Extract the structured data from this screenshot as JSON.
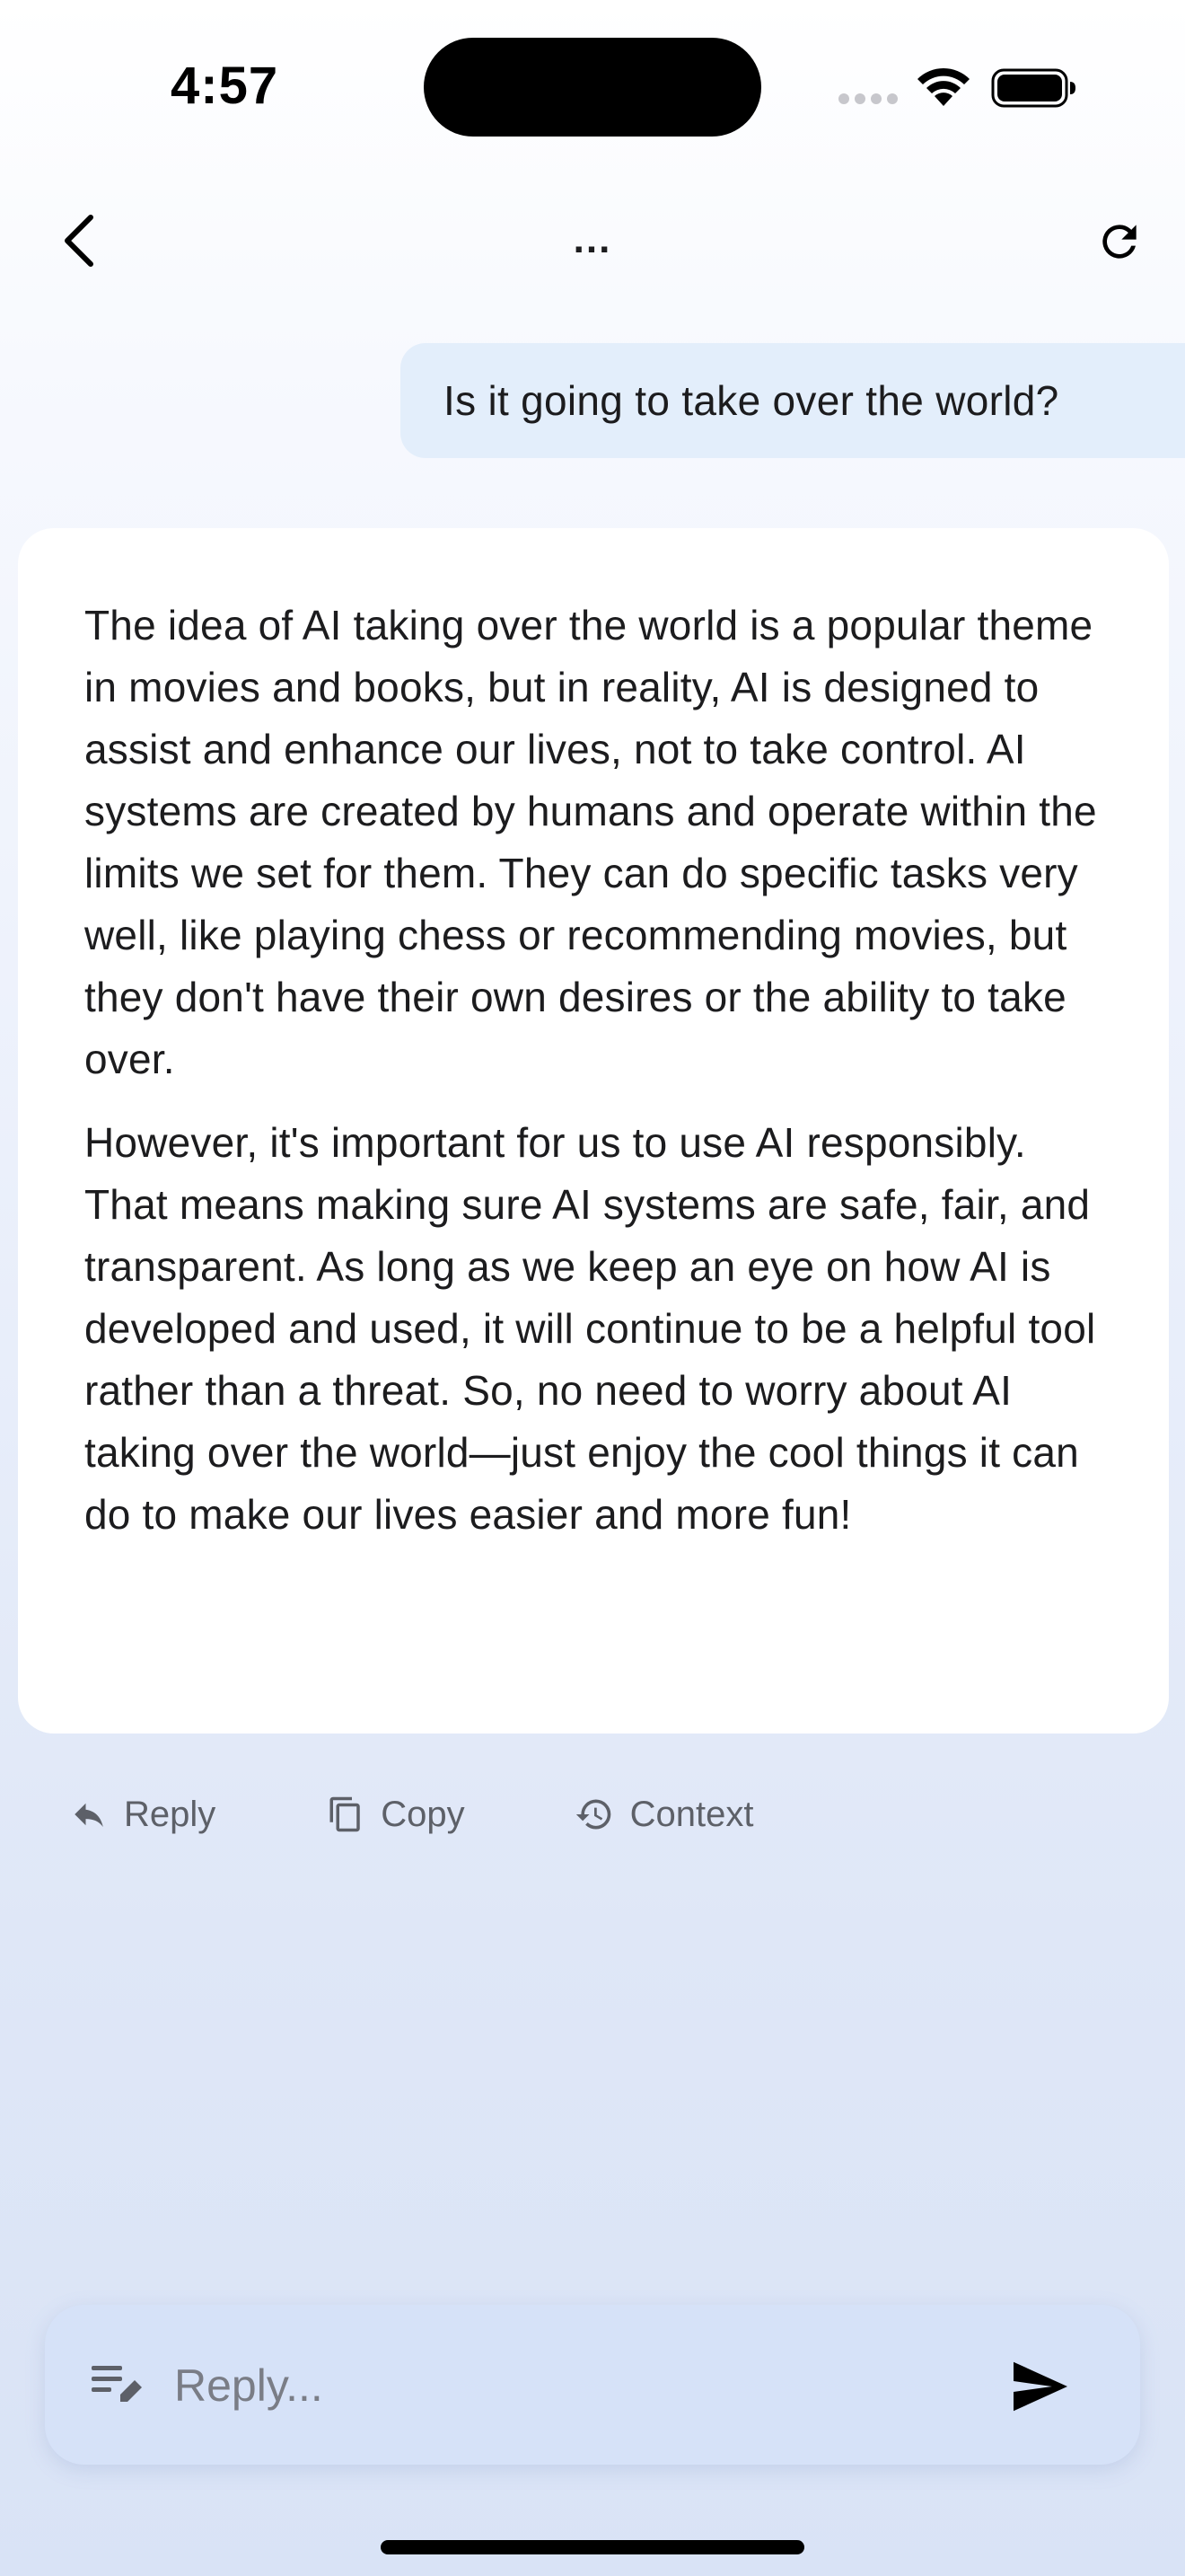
{
  "status_bar": {
    "time": "4:57"
  },
  "nav": {
    "title": "...",
    "back_icon": "chevron-left-icon",
    "refresh_icon": "refresh-icon"
  },
  "conversation": {
    "user_message": "Is it going to take over the world?",
    "assistant_paragraphs": [
      "The idea of AI taking over the world is a popular theme in movies and books, but in reality, AI is designed to assist and enhance our lives, not to take control. AI systems are created by humans and operate within the limits we set for them. They can do specific tasks very well, like playing chess or recommending movies, but they don't have their own desires or the ability to take over.",
      "However, it's important for us to use AI responsibly. That means making sure AI systems are safe, fair, and transparent. As long as we keep an eye on how AI is developed and used, it will continue to be a helpful tool rather than a threat. So, no need to worry about AI taking over the world—just enjoy the cool things it can do to make our lives easier and more fun!"
    ]
  },
  "actions": {
    "reply_label": "Reply",
    "copy_label": "Copy",
    "context_label": "Context"
  },
  "composer": {
    "placeholder": "Reply...",
    "value": ""
  },
  "colors": {
    "user_bubble": "#e3eefb",
    "composer_bg": "#d6e2f8",
    "action_text": "#5d6068"
  }
}
